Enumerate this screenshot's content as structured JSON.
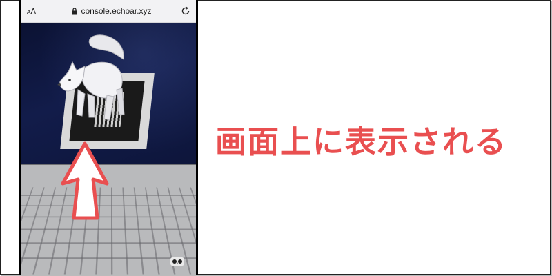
{
  "browser": {
    "text_size_label": "AA",
    "url": "console.echoar.xyz"
  },
  "headline": "画面上に表示される",
  "icons": {
    "lock": "lock-icon",
    "reload": "reload-icon",
    "vr": "vr-headset-icon",
    "arrow": "arrow-up-icon"
  },
  "colors": {
    "headline": "#e94f50",
    "arrow_fill": "#ffffff",
    "arrow_stroke": "#e94f50",
    "urlbar": "#f2f2f4"
  }
}
